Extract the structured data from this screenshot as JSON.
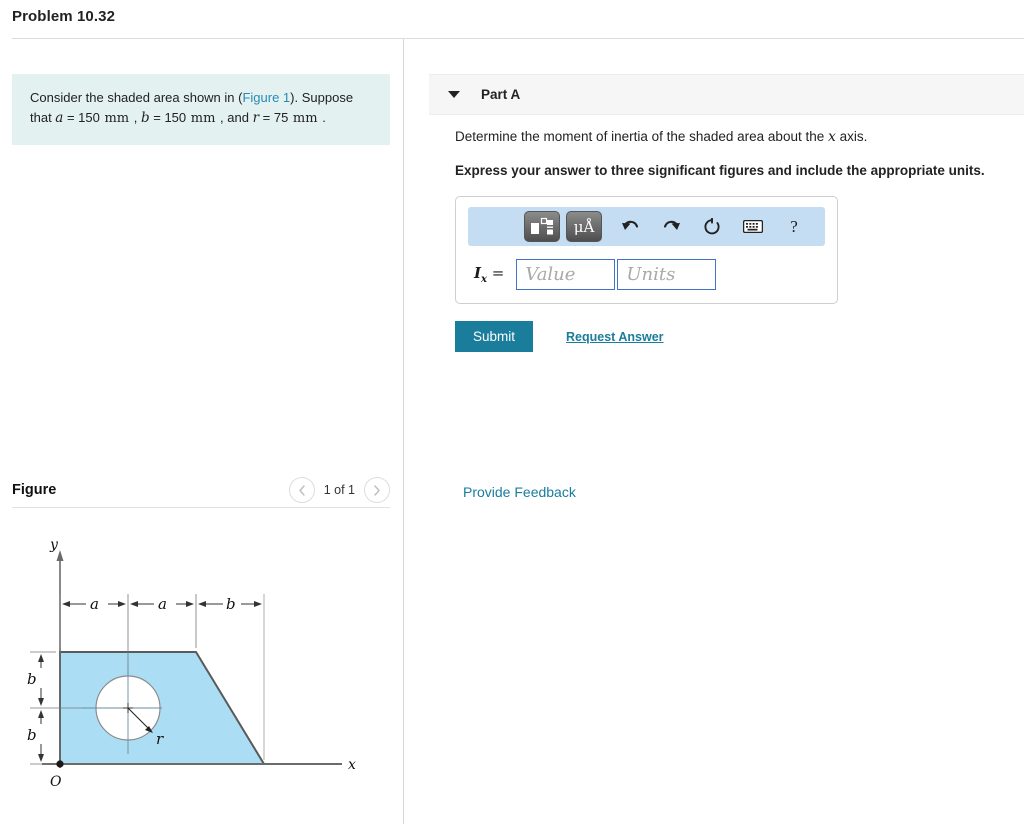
{
  "header": {
    "problem_title": "Problem 10.32"
  },
  "statement": {
    "text_before_link": "Consider the shaded area shown in (",
    "figure_link": "Figure 1",
    "text_after_link": "). Suppose that ",
    "var_a": "a",
    "eq1": " = 150 ",
    "unit1": "mm",
    "sep1": " , ",
    "var_b": "b",
    "eq2": " = 150 ",
    "unit2": "mm",
    "sep2": " , and ",
    "var_r": "r",
    "eq3": " = 75 ",
    "unit3": "mm",
    "period": " ."
  },
  "figure_panel": {
    "label": "Figure",
    "prev_icon": "chevron-left-icon",
    "count": "1 of 1",
    "next_icon": "chevron-right-icon"
  },
  "part_a": {
    "caret_icon": "caret-down-icon",
    "title": "Part A",
    "question_prefix": "Determine the moment of inertia of the shaded area about the ",
    "question_var": "x",
    "question_suffix": " axis.",
    "instruction": "Express your answer to three significant figures and include the appropriate units."
  },
  "answer": {
    "toolbar": [
      {
        "name": "math-template-icon",
        "label": ""
      },
      {
        "name": "units-icon",
        "label": "μÅ"
      },
      {
        "name": "undo-icon",
        "label": "↶"
      },
      {
        "name": "redo-icon",
        "label": "↷"
      },
      {
        "name": "reset-icon",
        "label": "⟳"
      },
      {
        "name": "keyboard-icon",
        "label": "⌨"
      },
      {
        "name": "help-icon",
        "label": "?"
      }
    ],
    "label_symbol": "I",
    "label_subscript": "x",
    "label_equals": " =",
    "value_placeholder": "Value",
    "units_placeholder": "Units",
    "value_current": "",
    "units_current": ""
  },
  "actions": {
    "submit_label": "Submit",
    "request_answer_label": "Request Answer",
    "provide_feedback_label": "Provide Feedback"
  },
  "colors": {
    "accent_teal": "#1a7d9c",
    "statement_bg": "#e3f1f0",
    "shape_fill": "#abdef5",
    "toolbar_bg": "#c5ddf2",
    "input_border": "#4472c4"
  },
  "figure_diagram": {
    "axis_y_label": "y",
    "axis_x_label": "x",
    "origin_label": "O",
    "dim_top": [
      "a",
      "a",
      "b"
    ],
    "dim_left": [
      "b",
      "b"
    ],
    "radius_label": "r",
    "description": "Shaded trapezoidal area with circular hole; origin O at lower-left, y axis up, x axis right"
  }
}
